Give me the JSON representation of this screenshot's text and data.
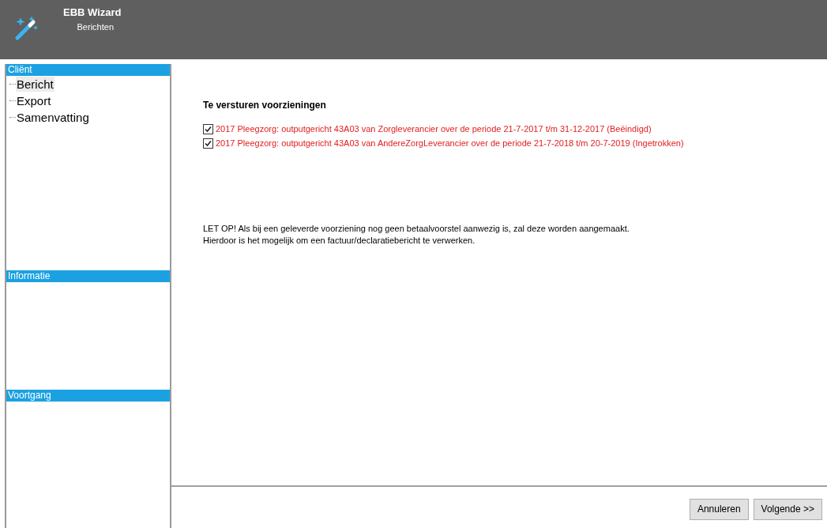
{
  "header": {
    "title": "EBB Wizard",
    "subtitle": "Berichten"
  },
  "sidebar": {
    "sections": [
      {
        "title": "Cliënt",
        "items": [
          {
            "label": "Bericht",
            "selected": true
          },
          {
            "label": "Export",
            "selected": false
          },
          {
            "label": "Samenvatting",
            "selected": false
          }
        ]
      },
      {
        "title": "Informatie"
      },
      {
        "title": "Voortgang"
      }
    ]
  },
  "main": {
    "heading": "Te versturen voorzieningen",
    "items": [
      {
        "label": "2017 Pleegzorg: outputgericht 43A03 van Zorgleverancier over de periode 21-7-2017 t/m 31-12-2017 (Beëindigd)",
        "checked": true
      },
      {
        "label": "2017 Pleegzorg: outputgericht 43A03 van AndereZorgLeverancier over de periode 21-7-2018 t/m 20-7-2019 (Ingetrokken)",
        "checked": true
      }
    ],
    "notice": [
      "LET OP! Als bij een geleverde voorziening nog geen betaalvoorstel aanwezig is, zal deze worden aangemaakt.",
      "Hierdoor is het mogelijk om een factuur/declaratiebericht te verwerken."
    ]
  },
  "buttons": [
    "Annuleren",
    "Volgende >>"
  ]
}
